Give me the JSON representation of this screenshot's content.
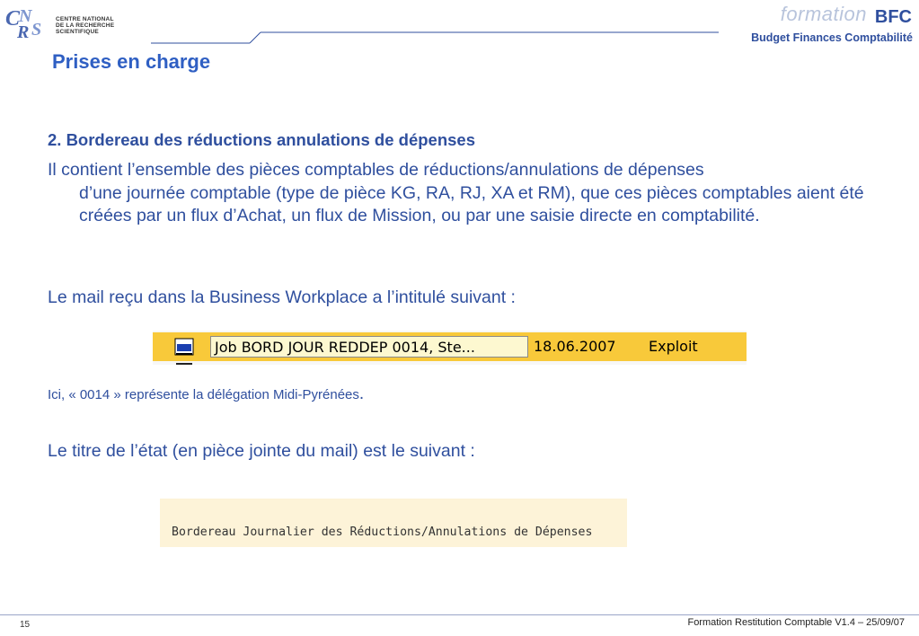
{
  "header": {
    "logo_lines": [
      "CENTRE NATIONAL",
      "DE LA RECHERCHE",
      "SCIENTIFIQUE"
    ],
    "brand_formation": "formation",
    "brand_bfc": "BFC",
    "brand_subtitle": "Budget Finances Comptabilité"
  },
  "slide": {
    "title": "Prises en charge",
    "section_heading": "2. Bordereau des réductions annulations de dépenses",
    "paragraph_first": "Il contient l’ensemble des pièces comptables de réductions/annulations de dépenses",
    "paragraph_rest": "d’une journée comptable (type de pièce KG, RA, RJ, XA et RM), que ces pièces comptables aient été créées par un flux d’Achat, un flux de Mission, ou par une saisie directe en comptabilité.",
    "mail_intro": "Le mail reçu dans la Business Workplace a l’intitulé suivant :",
    "note": "Ici, « 0014 » représente la délégation Midi-Pyrénées",
    "note_end": ".",
    "report_intro": "Le titre de l’état (en pièce jointe du mail) est le suivant :"
  },
  "mail_row": {
    "subject": "Job BORD JOUR REDDEP 0014, Ste...",
    "date": "18.06.2007",
    "status": "Exploit",
    "bar_color": "#f8c93a"
  },
  "report": {
    "title": "Bordereau Journalier des Réductions/Annulations de Dépenses"
  },
  "footer": {
    "page_number": "15",
    "text": "Formation Restitution Comptable V1.4 – 25/09/07"
  }
}
